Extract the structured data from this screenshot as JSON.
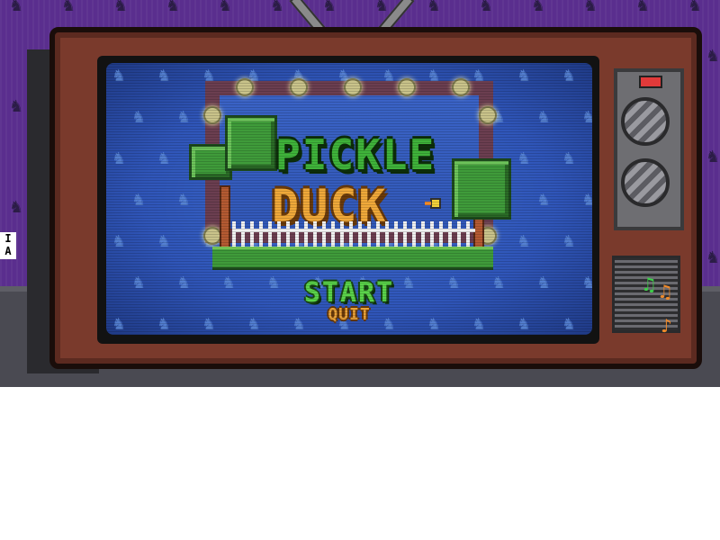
{
  "game": {
    "title_line1": "PICKLE",
    "title_line2": "DUCK",
    "menu": {
      "start_label": "START",
      "quit_label": "QUIT"
    },
    "hud_indicator": "I A",
    "music_notes": [
      "♫",
      "♫",
      "♪"
    ],
    "colors": {
      "wall": "#5a2e8e",
      "tv_body": "#7a3a2c",
      "screen": "#2f55b8",
      "start_text": "#5ad34a",
      "quit_text": "#e8a23a",
      "title_pickle": "#3fb33a",
      "title_duck": "#f0a93a"
    },
    "icons": [
      "antenna-icon",
      "power-led-icon",
      "volume-knob-icon",
      "channel-knob-icon",
      "speaker-grille-icon",
      "music-note-icon",
      "duck-sprite-icon"
    ]
  }
}
